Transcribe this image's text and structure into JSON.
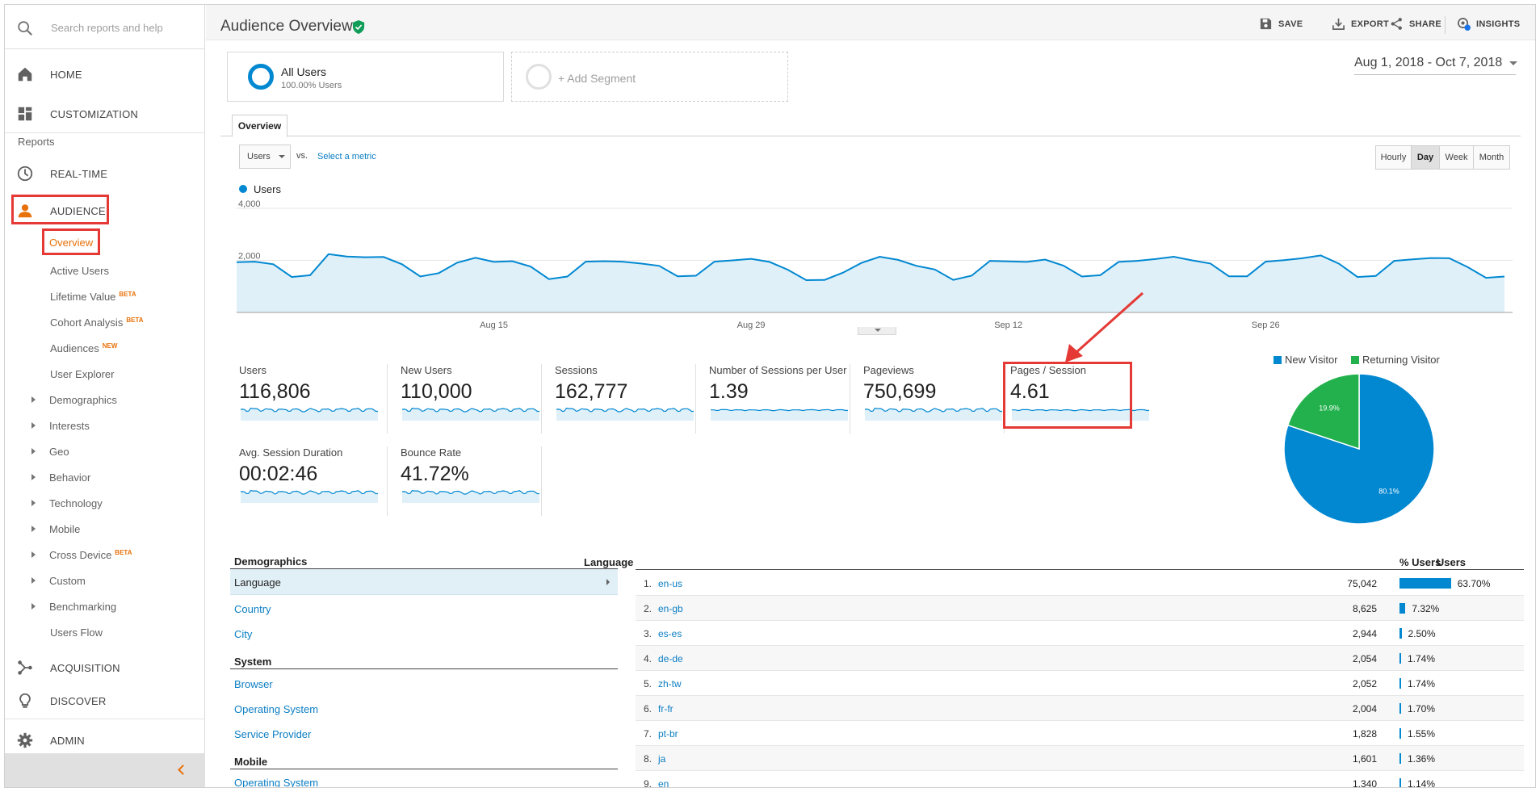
{
  "sidebar": {
    "search_placeholder": "Search reports and help",
    "top_items": [
      {
        "label": "HOME",
        "icon": "home-icon"
      },
      {
        "label": "CUSTOMIZATION",
        "icon": "dashboard-icon"
      }
    ],
    "reports_label": "Reports",
    "realtime": {
      "label": "REAL-TIME",
      "icon": "clock-icon"
    },
    "audience": {
      "label": "AUDIENCE",
      "icon": "person-icon",
      "color": "#e8710a"
    },
    "audience_items": [
      {
        "label": "Overview",
        "active": true
      },
      {
        "label": "Active Users"
      },
      {
        "label": "Lifetime Value",
        "badge": "BETA"
      },
      {
        "label": "Cohort Analysis",
        "badge": "BETA"
      },
      {
        "label": "Audiences",
        "badge": "NEW"
      },
      {
        "label": "User Explorer"
      }
    ],
    "expandable_items": [
      {
        "label": "Demographics"
      },
      {
        "label": "Interests"
      },
      {
        "label": "Geo"
      },
      {
        "label": "Behavior"
      },
      {
        "label": "Technology"
      },
      {
        "label": "Mobile"
      },
      {
        "label": "Cross Device",
        "badge": "BETA"
      },
      {
        "label": "Custom"
      },
      {
        "label": "Benchmarking"
      }
    ],
    "users_flow": "Users Flow",
    "bottom_items": [
      {
        "label": "ACQUISITION",
        "icon": "acquisition-icon"
      },
      {
        "label": "DISCOVER",
        "icon": "lightbulb-icon"
      },
      {
        "label": "ADMIN",
        "icon": "gear-icon"
      }
    ]
  },
  "header": {
    "title": "Audience Overview",
    "actions": [
      {
        "label": "SAVE",
        "icon": "save-icon"
      },
      {
        "label": "EXPORT",
        "icon": "export-icon"
      },
      {
        "label": "SHARE",
        "icon": "share-icon"
      },
      {
        "label": "INSIGHTS",
        "icon": "insights-icon"
      }
    ]
  },
  "segments": {
    "segment1_name": "All Users",
    "segment1_sub": "100.00% Users",
    "add_segment": "+ Add Segment"
  },
  "date_range": "Aug 1, 2018 - Oct 7, 2018",
  "tab_overview": "Overview",
  "metric_selector": {
    "value": "Users",
    "vs": "vs.",
    "select_metric": "Select a metric"
  },
  "granularity": [
    "Hourly",
    "Day",
    "Week",
    "Month"
  ],
  "granularity_active": "Day",
  "chart_data": {
    "type": "area",
    "legend": [
      "Users"
    ],
    "y_ticks": [
      "4,000",
      "2,000"
    ],
    "x_ticks": [
      "Aug 15",
      "Aug 29",
      "Sep 12",
      "Sep 26"
    ],
    "ylim": [
      0,
      4000
    ],
    "grid": true,
    "color": "#0288d1",
    "fill": "#dff0f9",
    "series": [
      {
        "name": "Users",
        "values": [
          1930,
          1950,
          1850,
          1360,
          1430,
          2240,
          2150,
          2120,
          2130,
          1850,
          1380,
          1510,
          1910,
          2100,
          1940,
          1970,
          1760,
          1280,
          1380,
          1950,
          1970,
          1950,
          1880,
          1790,
          1390,
          1410,
          1950,
          2000,
          2060,
          1940,
          1640,
          1240,
          1250,
          1530,
          1900,
          2140,
          2020,
          1790,
          1650,
          1250,
          1410,
          1980,
          1960,
          1940,
          2030,
          1800,
          1380,
          1430,
          1940,
          1980,
          2050,
          2140,
          2000,
          1880,
          1390,
          1390,
          1950,
          2010,
          2080,
          2190,
          1870,
          1360,
          1400,
          1980,
          2040,
          2090,
          2080,
          1740,
          1330,
          1380
        ]
      }
    ]
  },
  "metrics": [
    {
      "label": "Users",
      "value": "116,806"
    },
    {
      "label": "New Users",
      "value": "110,000"
    },
    {
      "label": "Sessions",
      "value": "162,777"
    },
    {
      "label": "Number of Sessions per User",
      "value": "1.39"
    },
    {
      "label": "Pageviews",
      "value": "750,699"
    },
    {
      "label": "Pages / Session",
      "value": "4.61"
    },
    {
      "label": "Avg. Session Duration",
      "value": "00:02:46"
    },
    {
      "label": "Bounce Rate",
      "value": "41.72%"
    }
  ],
  "pie": {
    "legend": [
      {
        "label": "New Visitor",
        "color": "#0288d1"
      },
      {
        "label": "Returning Visitor",
        "color": "#22b14c"
      }
    ],
    "slices": [
      {
        "label": "New Visitor",
        "value": 80.1,
        "text": "80.1%",
        "color": "#0288d1"
      },
      {
        "label": "Returning Visitor",
        "value": 19.9,
        "text": "19.9%",
        "color": "#22b14c"
      }
    ]
  },
  "demographics": {
    "title": "Demographics",
    "items": [
      "Language",
      "Country",
      "City"
    ],
    "system_title": "System",
    "system_items": [
      "Browser",
      "Operating System",
      "Service Provider"
    ],
    "mobile_title": "Mobile",
    "mobile_items": [
      "Operating System"
    ]
  },
  "language_table": {
    "header": "Language",
    "col_users": "Users",
    "col_pct": "% Users",
    "rows": [
      {
        "idx": "1.",
        "code": "en-us",
        "users": "75,042",
        "pct": "63.70%",
        "share": 63.7
      },
      {
        "idx": "2.",
        "code": "en-gb",
        "users": "8,625",
        "pct": "7.32%",
        "share": 7.32
      },
      {
        "idx": "3.",
        "code": "es-es",
        "users": "2,944",
        "pct": "2.50%",
        "share": 2.5
      },
      {
        "idx": "4.",
        "code": "de-de",
        "users": "2,054",
        "pct": "1.74%",
        "share": 1.74
      },
      {
        "idx": "5.",
        "code": "zh-tw",
        "users": "2,052",
        "pct": "1.74%",
        "share": 1.74
      },
      {
        "idx": "6.",
        "code": "fr-fr",
        "users": "2,004",
        "pct": "1.70%",
        "share": 1.7
      },
      {
        "idx": "7.",
        "code": "pt-br",
        "users": "1,828",
        "pct": "1.55%",
        "share": 1.55
      },
      {
        "idx": "8.",
        "code": "ja",
        "users": "1,601",
        "pct": "1.36%",
        "share": 1.36
      },
      {
        "idx": "9.",
        "code": "en",
        "users": "1,340",
        "pct": "1.14%",
        "share": 1.14
      }
    ]
  }
}
